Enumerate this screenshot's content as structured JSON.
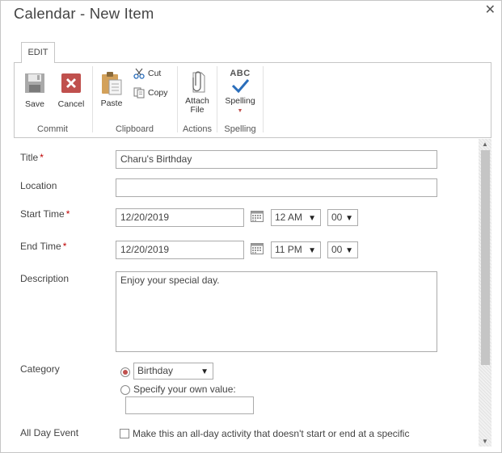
{
  "dialog": {
    "title": "Calendar - New Item",
    "close_glyph": "✕"
  },
  "ribbon": {
    "tab": "EDIT",
    "commit": {
      "label": "Commit",
      "save": "Save",
      "cancel": "Cancel"
    },
    "clipboard": {
      "label": "Clipboard",
      "paste": "Paste",
      "cut": "Cut",
      "copy": "Copy"
    },
    "actions": {
      "label": "Actions",
      "attach_line1": "Attach",
      "attach_line2": "File"
    },
    "spelling": {
      "label": "Spelling",
      "button": "Spelling",
      "abc": "ABC"
    }
  },
  "form": {
    "title": {
      "label": "Title",
      "req": "*",
      "value": "Charu's Birthday"
    },
    "location": {
      "label": "Location",
      "value": ""
    },
    "start": {
      "label": "Start Time",
      "req": "*",
      "date": "12/20/2019",
      "hour": "12 AM",
      "minute": "00"
    },
    "end": {
      "label": "End Time",
      "req": "*",
      "date": "12/20/2019",
      "hour": "11 PM",
      "minute": "00"
    },
    "description": {
      "label": "Description",
      "value": "Enjoy your special day."
    },
    "category": {
      "label": "Category",
      "selected": "Birthday",
      "own_value_label": "Specify your own value:",
      "own_value": ""
    },
    "all_day": {
      "label": "All Day Event",
      "text": "Make this an all-day activity that doesn't start or end at a specific"
    }
  },
  "colors": {
    "accent": "#c0504d",
    "border": "#ababab",
    "required": "#bf0000"
  }
}
